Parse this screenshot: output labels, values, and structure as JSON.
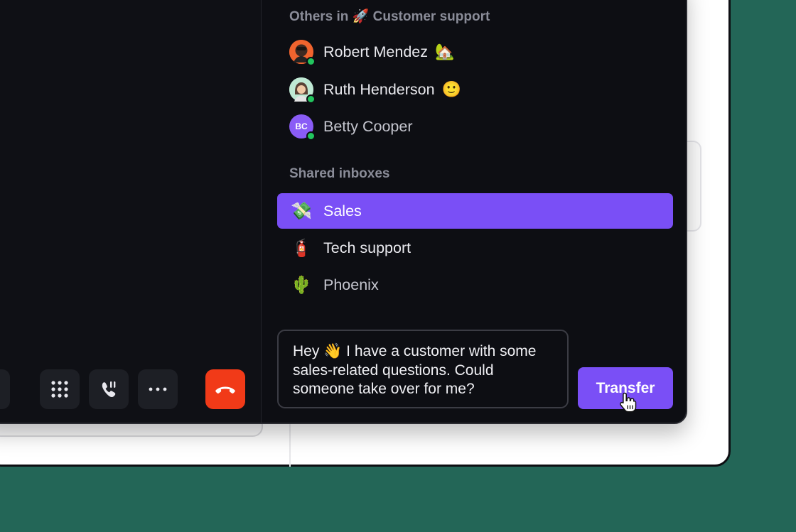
{
  "colors": {
    "background": "#236657",
    "panel": "#0d0e13",
    "accent": "#7a4ff6",
    "hangup": "#f13a18",
    "online": "#22c55e"
  },
  "call_controls": [
    {
      "name": "record-button",
      "icon": "record-icon"
    },
    {
      "name": "keypad-button",
      "icon": "keypad-icon"
    },
    {
      "name": "call-transfer-button",
      "icon": "phone-transfer-icon"
    },
    {
      "name": "more-button",
      "icon": "ellipsis-icon"
    },
    {
      "name": "hangup-button",
      "icon": "hangup-icon"
    }
  ],
  "others_section": {
    "prefix": "Others in",
    "team_emoji": "🚀",
    "team_name": "Customer support"
  },
  "people": [
    {
      "name": "Robert Mendez",
      "status_emoji": "🏡",
      "online": true
    },
    {
      "name": "Ruth Henderson",
      "status_emoji": "🙂",
      "online": true
    },
    {
      "name": "Betty Cooper",
      "initials": "BC",
      "online": true
    }
  ],
  "shared_inboxes": {
    "label": "Shared inboxes",
    "items": [
      {
        "emoji": "💸",
        "label": "Sales",
        "selected": true
      },
      {
        "emoji": "🧯",
        "label": "Tech support",
        "selected": false
      },
      {
        "emoji": "🌵",
        "label": "Phoenix",
        "selected": false
      }
    ]
  },
  "message": {
    "text": "Hey 👋 I have a customer with some sales-related questions. Could someone take over for me?"
  },
  "transfer_button": {
    "label": "Transfer"
  }
}
